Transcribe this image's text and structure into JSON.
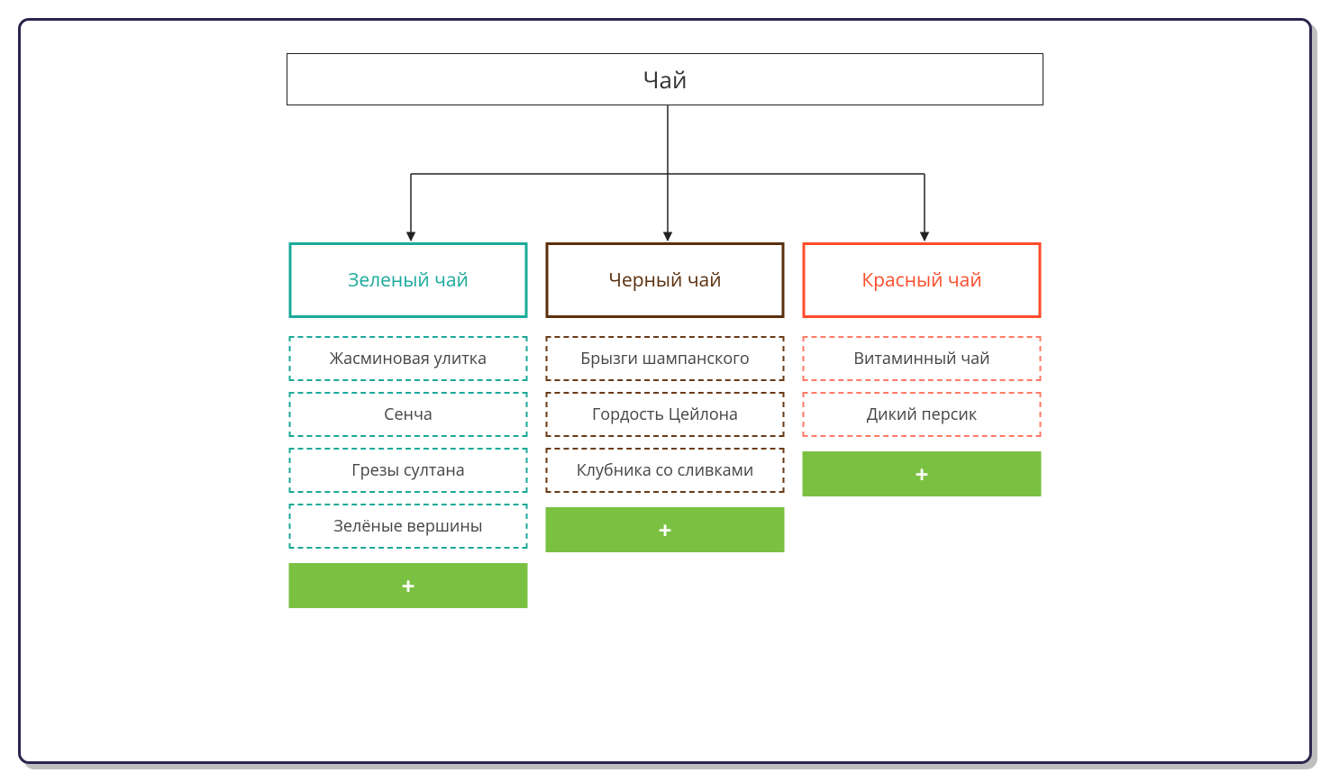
{
  "root": {
    "label": "Чай"
  },
  "categories": [
    {
      "label": "Зеленый чай",
      "colorClass": "green",
      "items": [
        "Жасминовая улитка",
        "Сенча",
        "Грезы султана",
        "Зелёные вершины"
      ]
    },
    {
      "label": "Черный чай",
      "colorClass": "brown",
      "items": [
        "Брызги шампанского",
        "Гордость Цейлона",
        "Клубника со сливками"
      ]
    },
    {
      "label": "Красный чай",
      "colorClass": "red",
      "items": [
        "Витаминный чай",
        "Дикий персик"
      ]
    }
  ],
  "addButton": {
    "label": "+"
  },
  "colors": {
    "green": "#1aa99a",
    "brown": "#5a2f0e",
    "red": "#ff4c2b",
    "addBg": "#7ac142",
    "frameBorder": "#2a254f"
  }
}
